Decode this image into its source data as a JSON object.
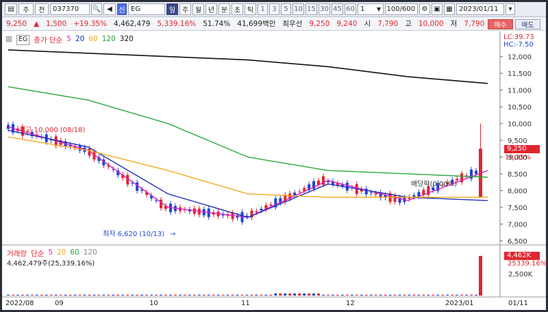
{
  "toolbar": {
    "kind_label": "주",
    "mode_label": "전",
    "code": "037370",
    "market_badge": "신",
    "name": "EG",
    "periods": [
      "일",
      "주",
      "월",
      "년",
      "분",
      "초",
      "틱"
    ],
    "minutes": [
      "1",
      "3",
      "5",
      "10",
      "15",
      "30",
      "45",
      "60"
    ],
    "range_value": "1",
    "count": "100/600",
    "date": "2023/01/11"
  },
  "info": {
    "price": "9,250",
    "arrow": "▲",
    "change": "1,500",
    "change_pct": "+19.35%",
    "volume": "4,462,479",
    "volume_pct": "5,339.16%",
    "turnover": "51.74%",
    "amount": "41,699백만",
    "best_label": "최우선",
    "best_ask": "9,250",
    "best_bid": "9,240",
    "open_label": "시",
    "open": "7,790",
    "high_label": "고",
    "high": "10,000",
    "low_label": "저",
    "low": "7,790",
    "buy_label": "매수",
    "sell_label": "매도"
  },
  "legend": {
    "name": "EG",
    "ma_label": "종가 단순",
    "ma": [
      {
        "period": "5",
        "color": "#e020c0"
      },
      {
        "period": "20",
        "color": "#1f2fb8"
      },
      {
        "period": "60",
        "color": "#f2a81d"
      },
      {
        "period": "120",
        "color": "#23a83a"
      },
      {
        "period": "320",
        "color": "#111111"
      }
    ]
  },
  "scale": {
    "lc": "LC:39.73",
    "hc": "HC:-7.50",
    "ticks": [
      "12,000",
      "11,500",
      "11,000",
      "10,500",
      "10,000",
      "9,500",
      "9,000",
      "8,500",
      "8,000",
      "7,500",
      "7,000",
      "6,500"
    ],
    "current_tag": "9,250",
    "current_pct": "19.35%"
  },
  "annotations": {
    "max": "최고 10,000 (08/18)",
    "min": "최저 6,620 (10/13)",
    "dividend": "배당락(0.00%)"
  },
  "volume": {
    "legend_label": "거래량",
    "ma_label": "단순",
    "ma": [
      {
        "period": "5",
        "color": "#e020c0"
      },
      {
        "period": "20",
        "color": "#f2a81d"
      },
      {
        "period": "60",
        "color": "#23a83a"
      },
      {
        "period": "120",
        "color": "#888888"
      }
    ],
    "sub": "4,462,479주(25,339.16%)",
    "tag": "4,462K",
    "tag_pct": "25339.16%",
    "tick": "2,500K"
  },
  "xaxis": [
    "2022/08",
    "09",
    "10",
    "11",
    "12",
    "2023/01",
    "01/11"
  ],
  "chart_data": {
    "type": "line",
    "title": "",
    "x": [
      "2022/08",
      "09",
      "10",
      "11",
      "12",
      "2023/01",
      "2023/01/11"
    ],
    "series": [
      {
        "name": "5",
        "values": [
          9900,
          9200,
          7500,
          7200,
          8300,
          7700,
          8600
        ]
      },
      {
        "name": "20",
        "values": [
          9800,
          9300,
          7900,
          7200,
          8200,
          7800,
          7700
        ]
      },
      {
        "name": "60",
        "values": [
          9600,
          9200,
          8600,
          7900,
          7800,
          7800,
          7800
        ]
      },
      {
        "name": "120",
        "values": [
          11100,
          10700,
          10000,
          9000,
          8600,
          8500,
          8400
        ]
      },
      {
        "name": "320",
        "values": [
          12200,
          12100,
          12000,
          11900,
          11700,
          11400,
          11200
        ]
      }
    ],
    "ylim": [
      6500,
      12300
    ]
  }
}
